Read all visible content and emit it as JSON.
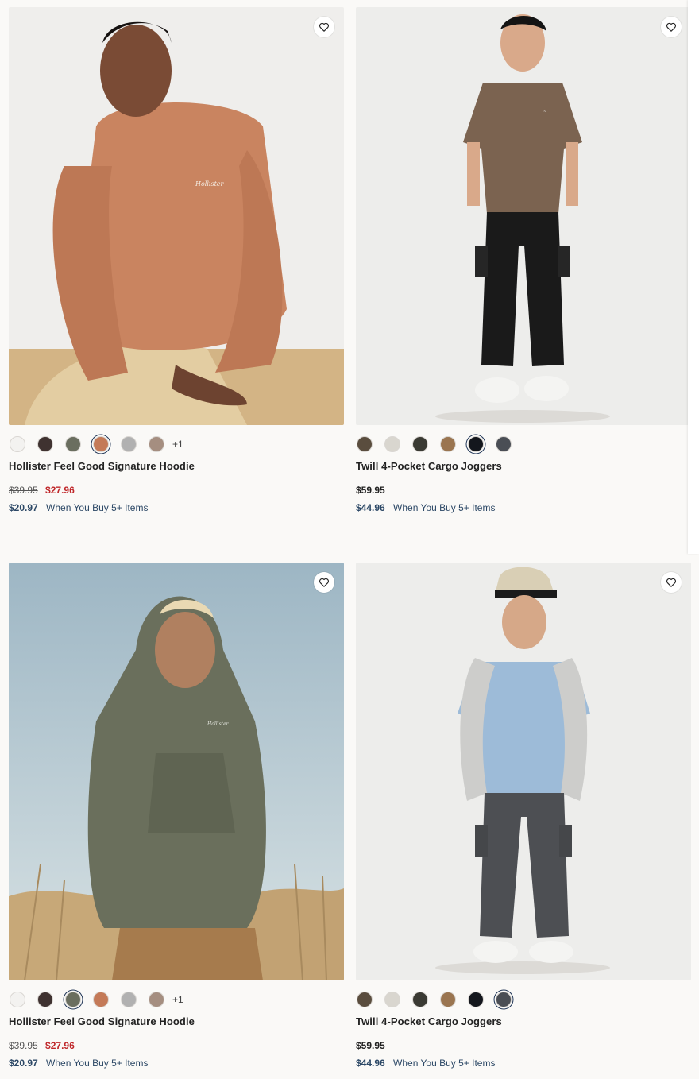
{
  "products": [
    {
      "name": "Hollister Feel Good Signature Hoodie",
      "original_price": "$39.95",
      "sale_price": "$27.96",
      "promo_price": "$20.97",
      "promo_text": "When You Buy 5+ Items",
      "more_colors": "+1",
      "swatches": [
        "#f3f2f0",
        "#3f3230",
        "#6a6e5f",
        "#c47a58",
        "#b1b1b1",
        "#a58e80"
      ],
      "selected_swatch": 3
    },
    {
      "name": "Twill 4-Pocket Cargo Joggers",
      "regular_price": "$59.95",
      "promo_price": "$44.96",
      "promo_text": "When You Buy 5+ Items",
      "swatches": [
        "#5a4d3e",
        "#d9d6cf",
        "#3a3a33",
        "#9a7550",
        "#14171d",
        "#4a4e55"
      ],
      "selected_swatch": 4
    },
    {
      "name": "Hollister Feel Good Signature Hoodie",
      "original_price": "$39.95",
      "sale_price": "$27.96",
      "promo_price": "$20.97",
      "promo_text": "When You Buy 5+ Items",
      "more_colors": "+1",
      "swatches": [
        "#f3f2f0",
        "#3f3230",
        "#6a6e5f",
        "#c47a58",
        "#b1b1b1",
        "#a58e80"
      ],
      "selected_swatch": 2
    },
    {
      "name": "Twill 4-Pocket Cargo Joggers",
      "regular_price": "$59.95",
      "promo_price": "$44.96",
      "promo_text": "When You Buy 5+ Items",
      "swatches": [
        "#5a4d3e",
        "#d9d6cf",
        "#3a3a33",
        "#9a7550",
        "#14171d",
        "#4a4e55"
      ],
      "selected_swatch": 5
    }
  ],
  "icons": {
    "wishlist": "heart-outline-icon"
  }
}
